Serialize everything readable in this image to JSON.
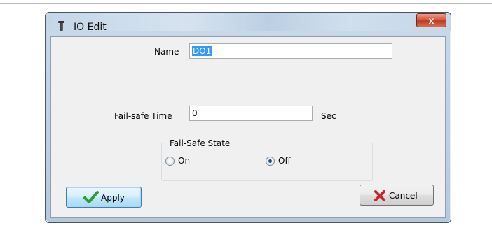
{
  "window": {
    "title": "IO Edit",
    "close_glyph": "x"
  },
  "form": {
    "name_label": "Name",
    "name_value": "DO1",
    "failsafe_time_label": "Fail-safe Time",
    "failsafe_time_value": "0",
    "failsafe_time_unit": "Sec",
    "failsafe_state_label": "Fail-Safe State",
    "state_options": [
      {
        "label": "On",
        "checked": false
      },
      {
        "label": "Off",
        "checked": true
      }
    ]
  },
  "buttons": {
    "apply_label": "Apply",
    "cancel_label": "Cancel"
  },
  "icons": {
    "title": "io-edit-app-icon",
    "apply": "checkmark-icon",
    "cancel": "red-x-icon"
  },
  "colors": {
    "title_bar": "#c4d6e8",
    "close_button": "#c9452a",
    "selection": "#3399ff",
    "apply_check": "#2e9e2a",
    "cancel_x": "#c62828"
  }
}
